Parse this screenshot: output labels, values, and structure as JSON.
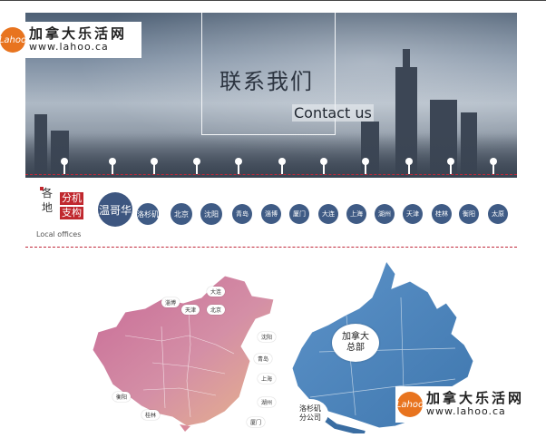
{
  "banner": {
    "title_cn": "联系我们",
    "title_en": "Contact us"
  },
  "watermark": {
    "brand_cn": "加拿大乐活网",
    "url": "www.lahoo.ca",
    "mark": "Lahoo"
  },
  "offices": {
    "label_chars": [
      "各",
      "地",
      "分机",
      "支构"
    ],
    "label_en": "Local offices",
    "cities": [
      "温哥华",
      "洛杉矶",
      "北京",
      "沈阳",
      "青岛",
      "淄博",
      "厦门",
      "大连",
      "上海",
      "湖州",
      "天津",
      "桂林",
      "衡阳",
      "太原"
    ]
  },
  "map": {
    "hq_label": [
      "加拿大",
      "总部"
    ],
    "la_label": [
      "洛杉矶",
      "分公司"
    ],
    "china_tags": [
      "大连",
      "淄博",
      "天津",
      "北京",
      "沈阳",
      "青岛",
      "上海",
      "湖州",
      "衡阳",
      "桂林",
      "厦门"
    ]
  }
}
